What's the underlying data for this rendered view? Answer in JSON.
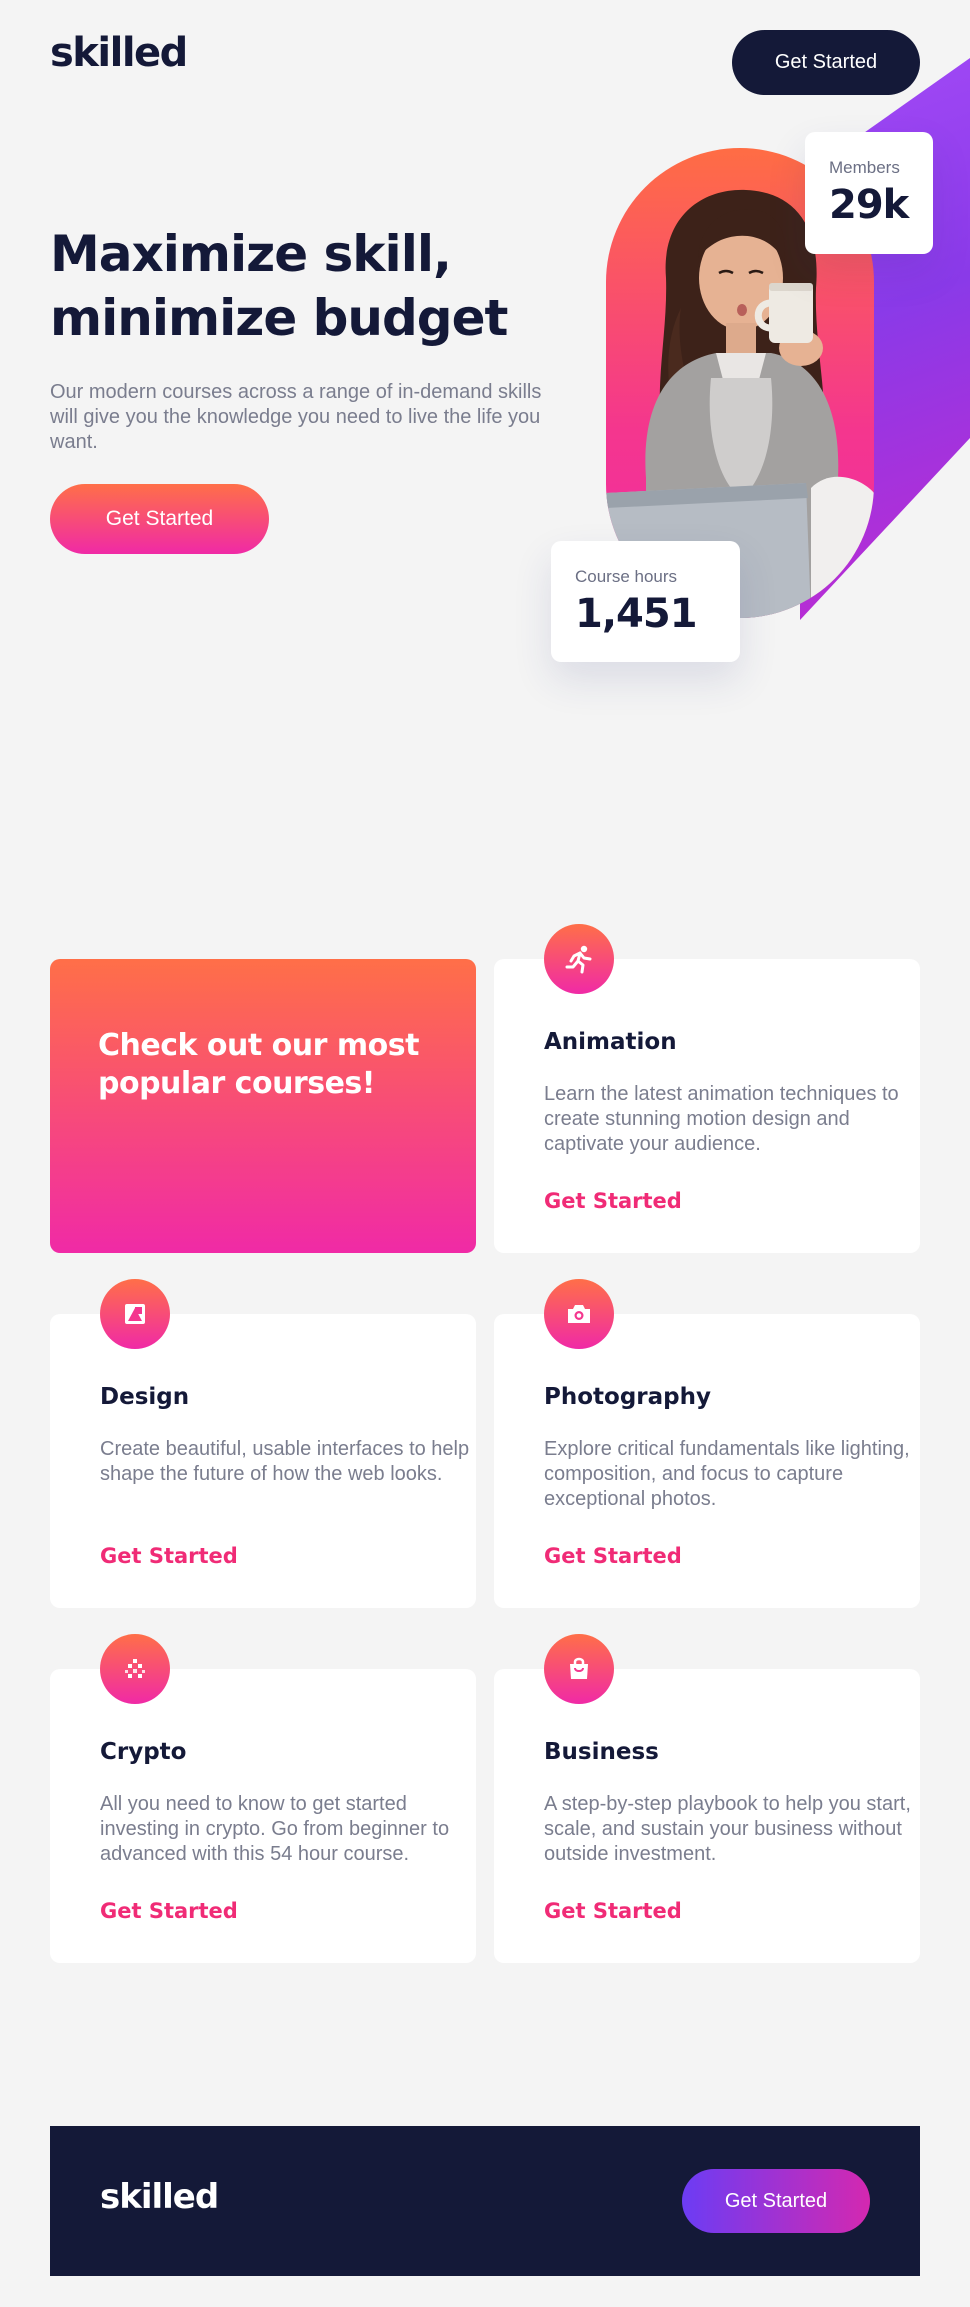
{
  "header": {
    "logo": "skilled",
    "cta_label": "Get Started"
  },
  "hero": {
    "title": "Maximize skill, minimize budget",
    "description": "Our modern courses across a range of in-demand skills will give you the knowledge you need to live the life you want.",
    "cta_label": "Get Started",
    "image_alt": "woman-drinking-coffee-photo"
  },
  "stats": {
    "members": {
      "label": "Members",
      "value": "29k"
    },
    "course_hours": {
      "label": "Course hours",
      "value": "1,451"
    }
  },
  "courses": {
    "promo_title": "Check out our most popular courses!",
    "items": [
      {
        "title": "Animation",
        "description": "Learn the latest animation techniques to create stunning motion design and captivate your audience.",
        "link": "Get Started",
        "icon": "running-person-icon"
      },
      {
        "title": "Design",
        "description": "Create beautiful, usable interfaces to help shape the future of how the web looks.",
        "link": "Get Started",
        "icon": "design-icon"
      },
      {
        "title": "Photography",
        "description": "Explore critical fundamentals like lighting, composition, and focus to capture exceptional photos.",
        "link": "Get Started",
        "icon": "camera-icon"
      },
      {
        "title": "Crypto",
        "description": "All you need to know to get started investing in crypto. Go from beginner to advanced with this 54 hour course.",
        "link": "Get Started",
        "icon": "crypto-icon"
      },
      {
        "title": "Business",
        "description": "A step-by-step playbook to help you start, scale, and sustain your business without outside investment.",
        "link": "Get Started",
        "icon": "shopping-bag-icon"
      }
    ]
  },
  "footer": {
    "logo": "skilled",
    "cta_label": "Get Started"
  },
  "colors": {
    "navy": "#141938",
    "gradient_start": "#ff6f48",
    "gradient_end": "#f02aa6",
    "link_pink": "#f02b76",
    "purple": "#8a3ae8",
    "background": "#f4f4f4",
    "body_text": "#7a7d8e"
  }
}
